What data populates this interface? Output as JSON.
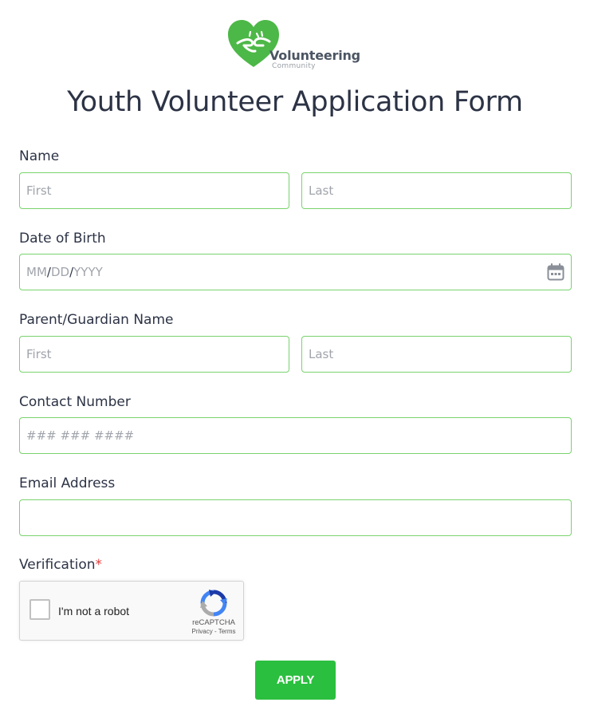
{
  "logo": {
    "word": "Volunteering",
    "sub": "Community",
    "colors": {
      "heart": "#4cb847",
      "text": "#4b5563"
    }
  },
  "form": {
    "title": "Youth Volunteer Application Form",
    "name": {
      "label": "Name",
      "first_placeholder": "First",
      "last_placeholder": "Last"
    },
    "dob": {
      "label": "Date of Birth",
      "mm": "MM",
      "dd": "DD",
      "yyyy": "YYYY",
      "sep": "/"
    },
    "guardian": {
      "label": "Parent/Guardian Name",
      "first_placeholder": "First",
      "last_placeholder": "Last"
    },
    "contact": {
      "label": "Contact Number",
      "placeholder": "### ### ####"
    },
    "email": {
      "label": "Email Address",
      "placeholder": ""
    },
    "verification": {
      "label": "Verification",
      "required_mark": "*"
    },
    "captcha": {
      "text": "I'm not a robot",
      "brand": "reCAPTCHA",
      "privacy": "Privacy",
      "dash": " - ",
      "terms": "Terms"
    },
    "submit_label": "APPLY"
  },
  "colors": {
    "field_border": "#7ad36e",
    "button": "#2bbf3f",
    "required": "#e23c3c",
    "text": "#2c3345"
  }
}
